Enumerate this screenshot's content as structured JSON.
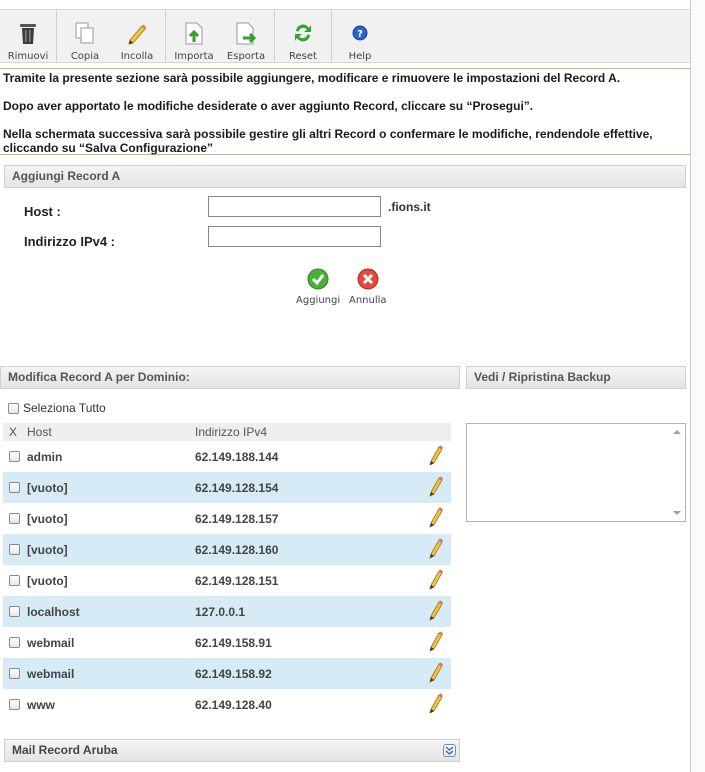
{
  "toolbar": {
    "buttons": [
      {
        "label": "Rimuovi",
        "icon": "trash-icon"
      },
      {
        "label": "Copia",
        "icon": "copy-icon"
      },
      {
        "label": "Incolla",
        "icon": "paste-icon"
      },
      {
        "label": "Importa",
        "icon": "import-icon"
      },
      {
        "label": "Esporta",
        "icon": "export-icon"
      },
      {
        "label": "Reset",
        "icon": "reset-icon"
      },
      {
        "label": "Help",
        "icon": "help-icon"
      }
    ]
  },
  "info": {
    "line1": "Tramite la presente sezione sarà possibile aggiungere, modificare e rimuovere le impostazioni del Record A.",
    "line2": "Dopo aver apportato le modifiche desiderate o aver aggiunto Record, cliccare su “Prosegui”.",
    "line3": "Nella schermata successiva sarà possibile gestire gli altri Record o confermare le modifiche, rendendole effettive, cliccando su “Salva Configurazione”"
  },
  "add_section": {
    "title": "Aggiungi Record A",
    "host_label": "Host :",
    "host_value": "",
    "host_suffix": ".fions.it",
    "ip_label": "Indirizzo IPv4 :",
    "ip_value": "",
    "add_label": "Aggiungi",
    "cancel_label": "Annulla"
  },
  "modify_section": {
    "title": "Modifica Record A per Dominio:",
    "select_all": "Seleziona Tutto",
    "col_x": "X",
    "col_host": "Host",
    "col_ip": "Indirizzo IPv4",
    "records": [
      {
        "host": "admin",
        "ip": "62.149.188.144"
      },
      {
        "host": "[vuoto]",
        "ip": "62.149.128.154"
      },
      {
        "host": "[vuoto]",
        "ip": "62.149.128.157"
      },
      {
        "host": "[vuoto]",
        "ip": "62.149.128.160"
      },
      {
        "host": "[vuoto]",
        "ip": "62.149.128.151"
      },
      {
        "host": "localhost",
        "ip": "127.0.0.1"
      },
      {
        "host": "webmail",
        "ip": "62.149.158.91"
      },
      {
        "host": "webmail",
        "ip": "62.149.158.92"
      },
      {
        "host": "www",
        "ip": "62.149.128.40"
      }
    ]
  },
  "backup_section": {
    "title": "Vedi / Ripristina Backup"
  },
  "mail_section": {
    "title": "Mail Record Aruba"
  }
}
